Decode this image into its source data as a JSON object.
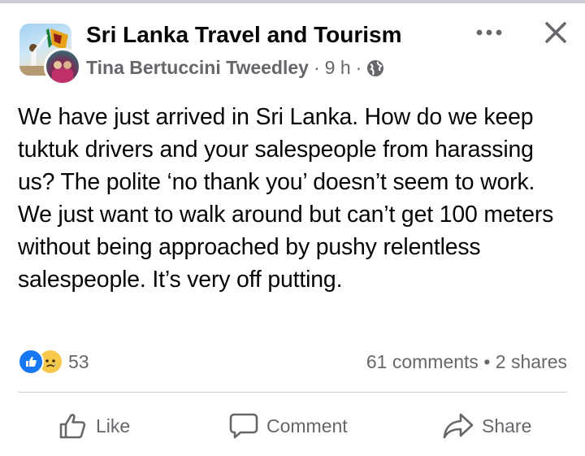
{
  "post": {
    "group_name": "Sri Lanka Travel and Tourism",
    "author": "Tina Bertuccini Tweedley",
    "time": "9 h",
    "meta_separator": "·",
    "body": "We have just arrived in Sri Lanka. How do we keep tuktuk drivers and your salespeople from harassing us? The polite ‘no thank you’ doesn’t seem to work. We just want to walk around but can’t get 100 meters without being approached by pushy relentless salespeople. It’s very off putting.",
    "reaction_icons": [
      "like-icon",
      "sad-icon"
    ],
    "reaction_count": "53",
    "comments": "61 comments",
    "shares": "2 shares",
    "counts_separator": "•"
  },
  "actions": {
    "like_label": "Like",
    "comment_label": "Comment",
    "share_label": "Share"
  },
  "icons": {
    "more": "more-icon",
    "close": "close-icon",
    "globe": "globe-icon"
  },
  "colors": {
    "text": "#050505",
    "secondary": "#65676b",
    "like_blue": "#1877f2",
    "sad_yellow": "#f7c94b",
    "divider": "#ced0d4"
  }
}
